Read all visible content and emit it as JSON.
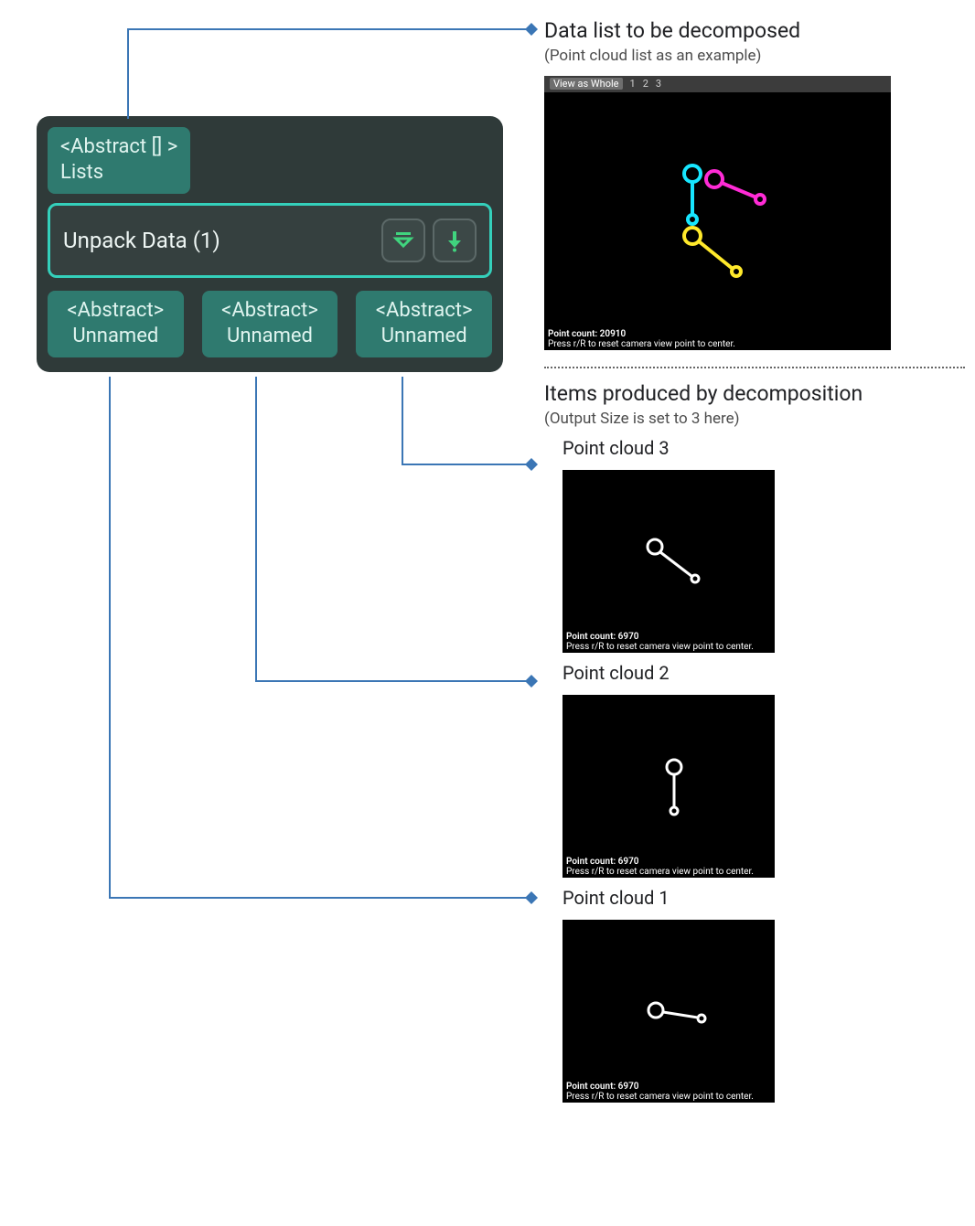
{
  "node": {
    "input": {
      "type": "<Abstract [] >",
      "name": "Lists"
    },
    "title": "Unpack Data (1)",
    "icons": {
      "reorder": "reorder-icon",
      "down": "arrow-down-icon"
    },
    "outputs": [
      {
        "type": "<Abstract>",
        "name": "Unnamed"
      },
      {
        "type": "<Abstract>",
        "name": "Unnamed"
      },
      {
        "type": "<Abstract>",
        "name": "Unnamed"
      }
    ]
  },
  "annotations": {
    "input": {
      "title": "Data list to be decomposed",
      "sub": "(Point cloud list as an example)"
    },
    "outputs": {
      "title": "Items produced by decomposition",
      "sub": "(Output Size is set to 3 here)"
    }
  },
  "viewer_main": {
    "tabs": {
      "whole": "View as Whole",
      "nums": [
        "1",
        "2",
        "3"
      ]
    },
    "point_count_label": "Point count:",
    "point_count": "20910",
    "hint": "Press r/R to reset camera view point to center."
  },
  "items": [
    {
      "label": "Point cloud 3",
      "point_count_label": "Point count:",
      "point_count": "6970",
      "hint": "Press r/R to reset camera view point to center."
    },
    {
      "label": "Point cloud 2",
      "point_count_label": "Point count:",
      "point_count": "6970",
      "hint": "Press r/R to reset camera view point to center."
    },
    {
      "label": "Point cloud 1",
      "point_count_label": "Point count:",
      "point_count": "6970",
      "hint": "Press r/R to reset camera view point to center."
    }
  ]
}
